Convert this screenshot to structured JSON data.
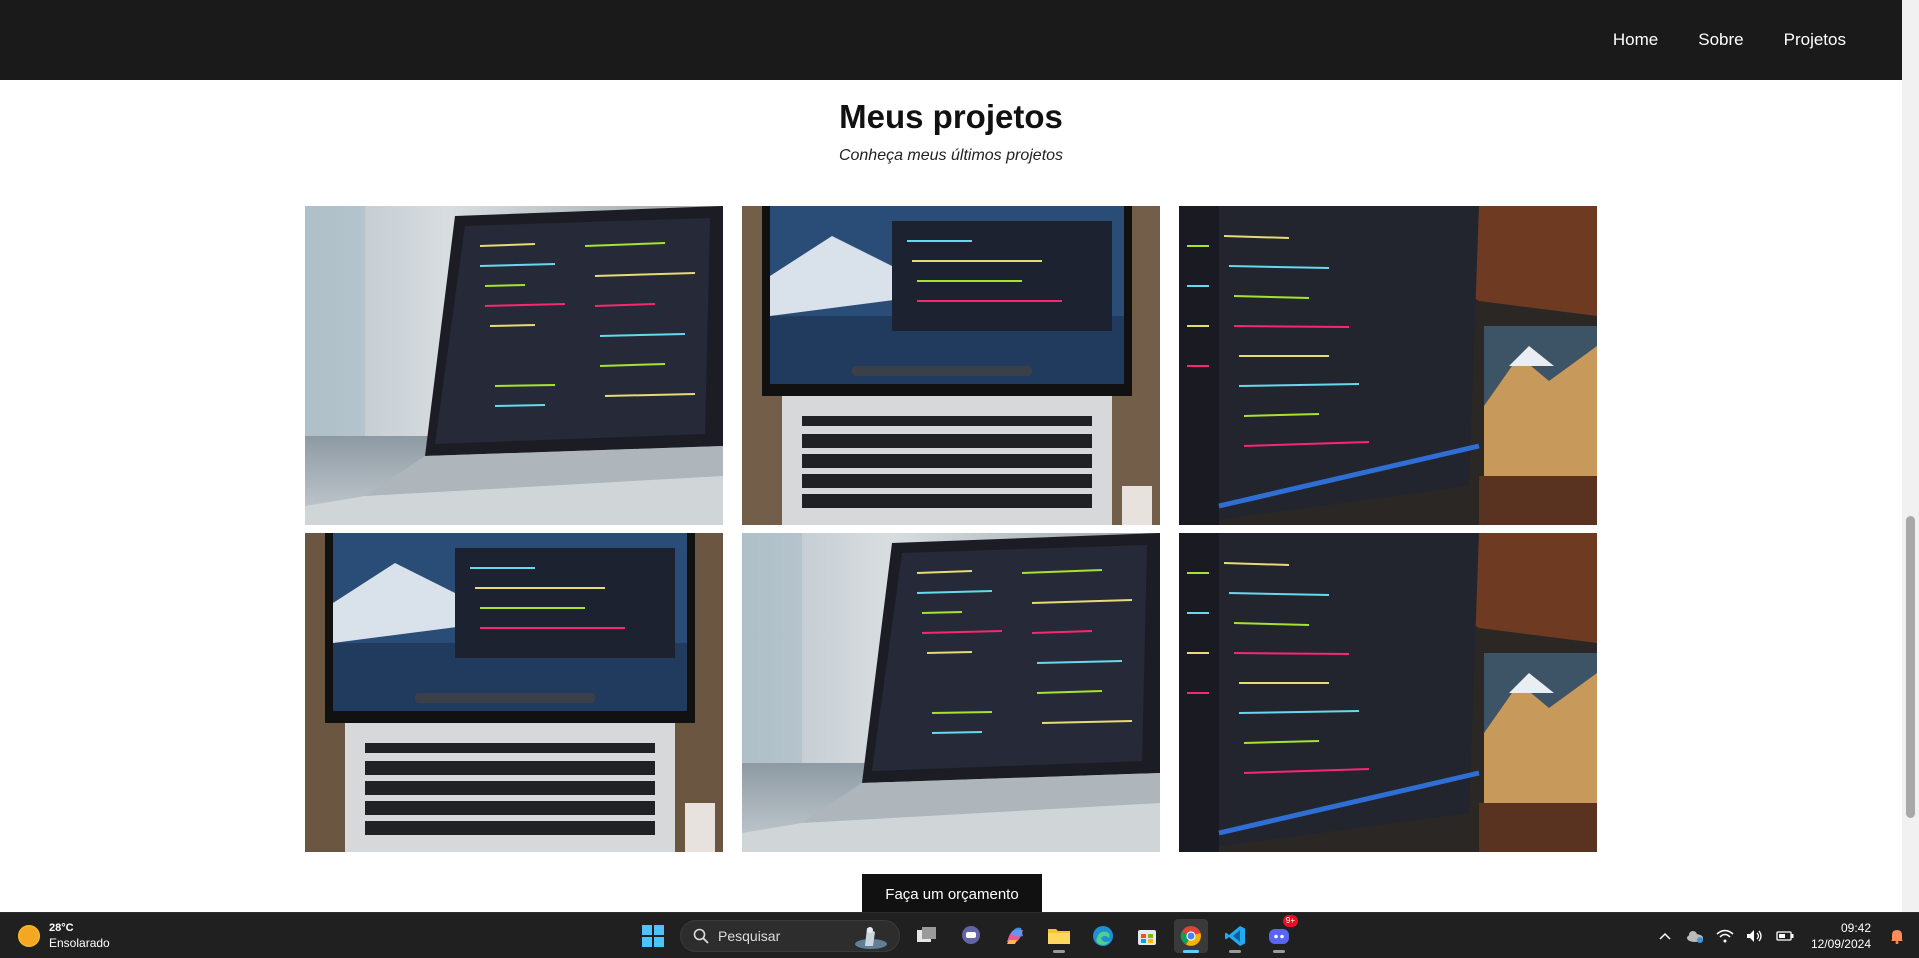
{
  "nav": {
    "links": [
      "Home",
      "Sobre",
      "Projetos"
    ]
  },
  "section": {
    "title": "Meus projetos",
    "subtitle": "Conheça meus últimos projetos"
  },
  "projects": [
    {
      "image": "laptop-code-side-view"
    },
    {
      "image": "laptop-mountain-wallpaper-top-view"
    },
    {
      "image": "monitor-code-closeup"
    },
    {
      "image": "laptop-mountain-wallpaper-top-view"
    },
    {
      "image": "laptop-code-side-view"
    },
    {
      "image": "monitor-code-closeup"
    }
  ],
  "cta": {
    "label": "Faça um orçamento"
  },
  "taskbar": {
    "weather": {
      "temp": "28°C",
      "condition": "Ensolarado"
    },
    "search_placeholder": "Pesquisar",
    "apps": [
      "start-icon",
      "task-view-icon",
      "chat-icon",
      "copilot-icon",
      "file-explorer-icon",
      "edge-icon",
      "store-icon",
      "chrome-icon",
      "vscode-icon",
      "discord-icon"
    ],
    "discord_badge": "9+",
    "clock": {
      "time": "09:42",
      "date": "12/09/2024"
    }
  },
  "colors": {
    "navbar": "#1a1a1a",
    "cta": "#111111",
    "taskbar": "#202020"
  }
}
